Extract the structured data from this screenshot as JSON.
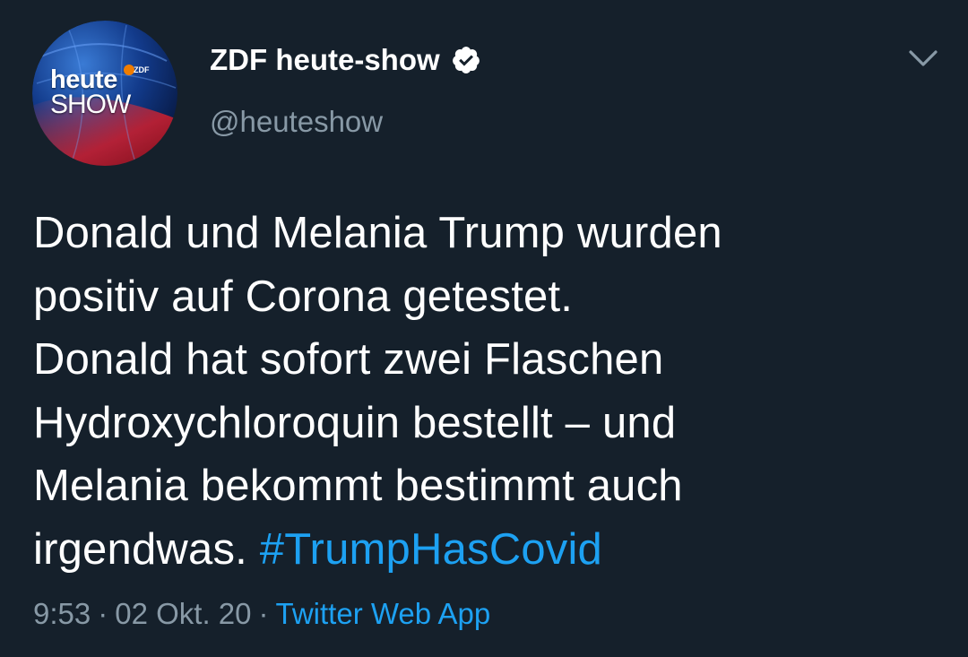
{
  "avatar": {
    "word1": "heute",
    "word2": "SHOW",
    "badge": "ZDF"
  },
  "user": {
    "display_name": "ZDF heute-show",
    "handle": "@heuteshow",
    "verified_icon": "verified-badge-icon"
  },
  "menu": {
    "icon": "chevron-down-icon"
  },
  "tweet": {
    "lines": [
      "Donald und Melania Trump wurden",
      "positiv auf Corona getestet.",
      "Donald hat sofort zwei Flaschen",
      "Hydroxychloroquin bestellt – und",
      "Melania bekommt bestimmt auch"
    ],
    "last_line_text": "irgendwas.",
    "hashtag": "#TrumpHasCovid"
  },
  "meta": {
    "time": "9:53",
    "separator": "·",
    "date": "02 Okt. 20",
    "source": "Twitter Web App"
  },
  "colors": {
    "background": "#15202b",
    "text": "#ffffff",
    "secondary": "#8899a6",
    "accent": "#1da1f2"
  }
}
